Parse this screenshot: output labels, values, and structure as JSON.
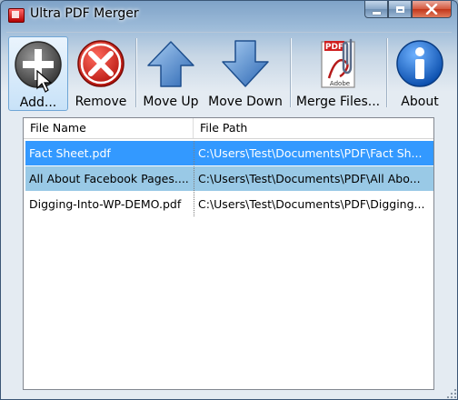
{
  "window": {
    "title": "Ultra PDF Merger"
  },
  "toolbar": {
    "add_label": "Add...",
    "remove_label": "Remove",
    "move_up_label": "Move Up",
    "move_down_label": "Move Down",
    "merge_label": "Merge Files...",
    "about_label": "About",
    "pdf_badge": "PDF",
    "adobe_text": "Adobe"
  },
  "table": {
    "columns": [
      "File Name",
      "File Path"
    ],
    "rows": [
      {
        "name": "Fact Sheet.pdf",
        "path": "C:\\Users\\Test\\Documents\\PDF\\Fact Sh..."
      },
      {
        "name": "All About Facebook Pages....",
        "path": "C:\\Users\\Test\\Documents\\PDF\\All Abo..."
      },
      {
        "name": "Digging-Into-WP-DEMO.pdf",
        "path": "C:\\Users\\Test\\Documents\\PDF\\Digging..."
      }
    ]
  },
  "colors": {
    "selection_primary": "#3399ff",
    "selection_secondary": "#99c9e6",
    "remove_red": "#d7261e",
    "arrow_blue": "#3b7fd0",
    "about_blue": "#1b6fd1"
  },
  "icons": {
    "add": "plus-circle-icon",
    "remove": "x-circle-icon",
    "move_up": "arrow-up-icon",
    "move_down": "arrow-down-icon",
    "merge": "pdf-paperclip-icon",
    "about": "info-circle-icon",
    "cursor": "mouse-pointer-icon"
  }
}
